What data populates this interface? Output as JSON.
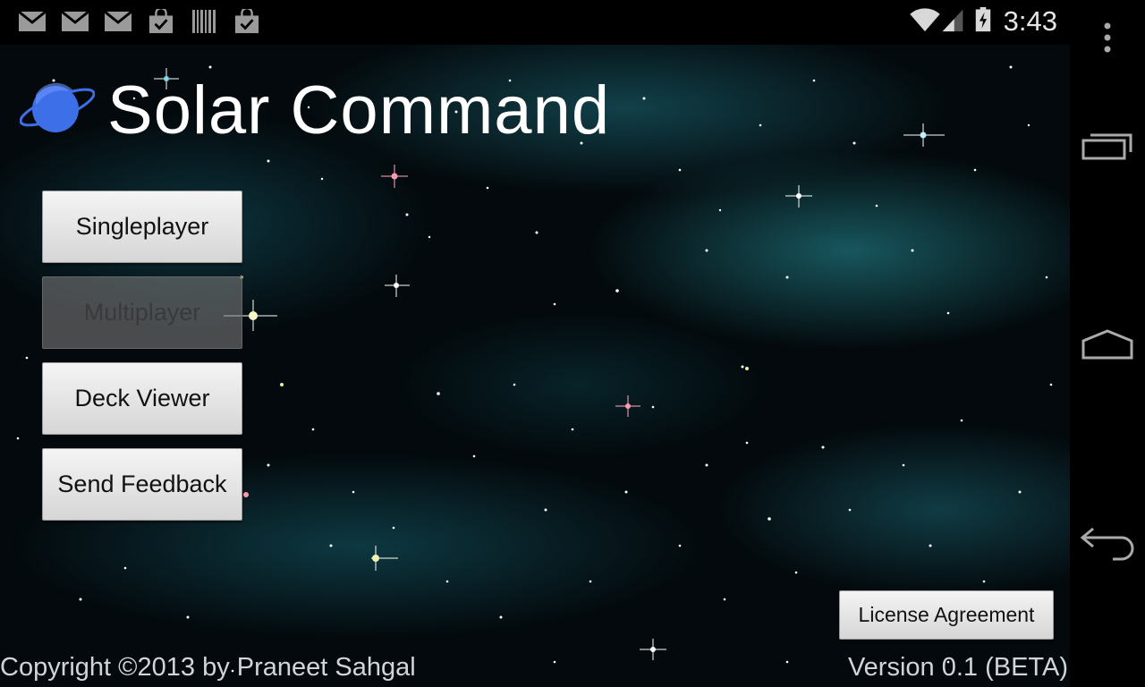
{
  "status_bar": {
    "notification_icons": [
      "gmail-icon",
      "gmail-icon",
      "gmail-icon",
      "store-icon",
      "barcode-icon",
      "store-icon"
    ],
    "time": "3:43"
  },
  "app": {
    "title": "Solar Command",
    "menu": [
      {
        "label": "Singleplayer",
        "enabled": true
      },
      {
        "label": "Multiplayer",
        "enabled": false
      },
      {
        "label": "Deck Viewer",
        "enabled": true
      },
      {
        "label": "Send Feedback",
        "enabled": true
      }
    ],
    "license_label": "License Agreement",
    "copyright": "Copyright ©2013 by Praneet Sahgal",
    "version": "Version 0.1 (BETA)"
  },
  "nav_bar": {
    "items": [
      "overflow-menu-icon",
      "recent-apps-icon",
      "home-icon",
      "back-icon"
    ]
  },
  "colors": {
    "background": "#000000",
    "nebula": "#1e6e7d",
    "logo_blue": "#3d6fe8",
    "button_face": "#e6e6e6"
  }
}
